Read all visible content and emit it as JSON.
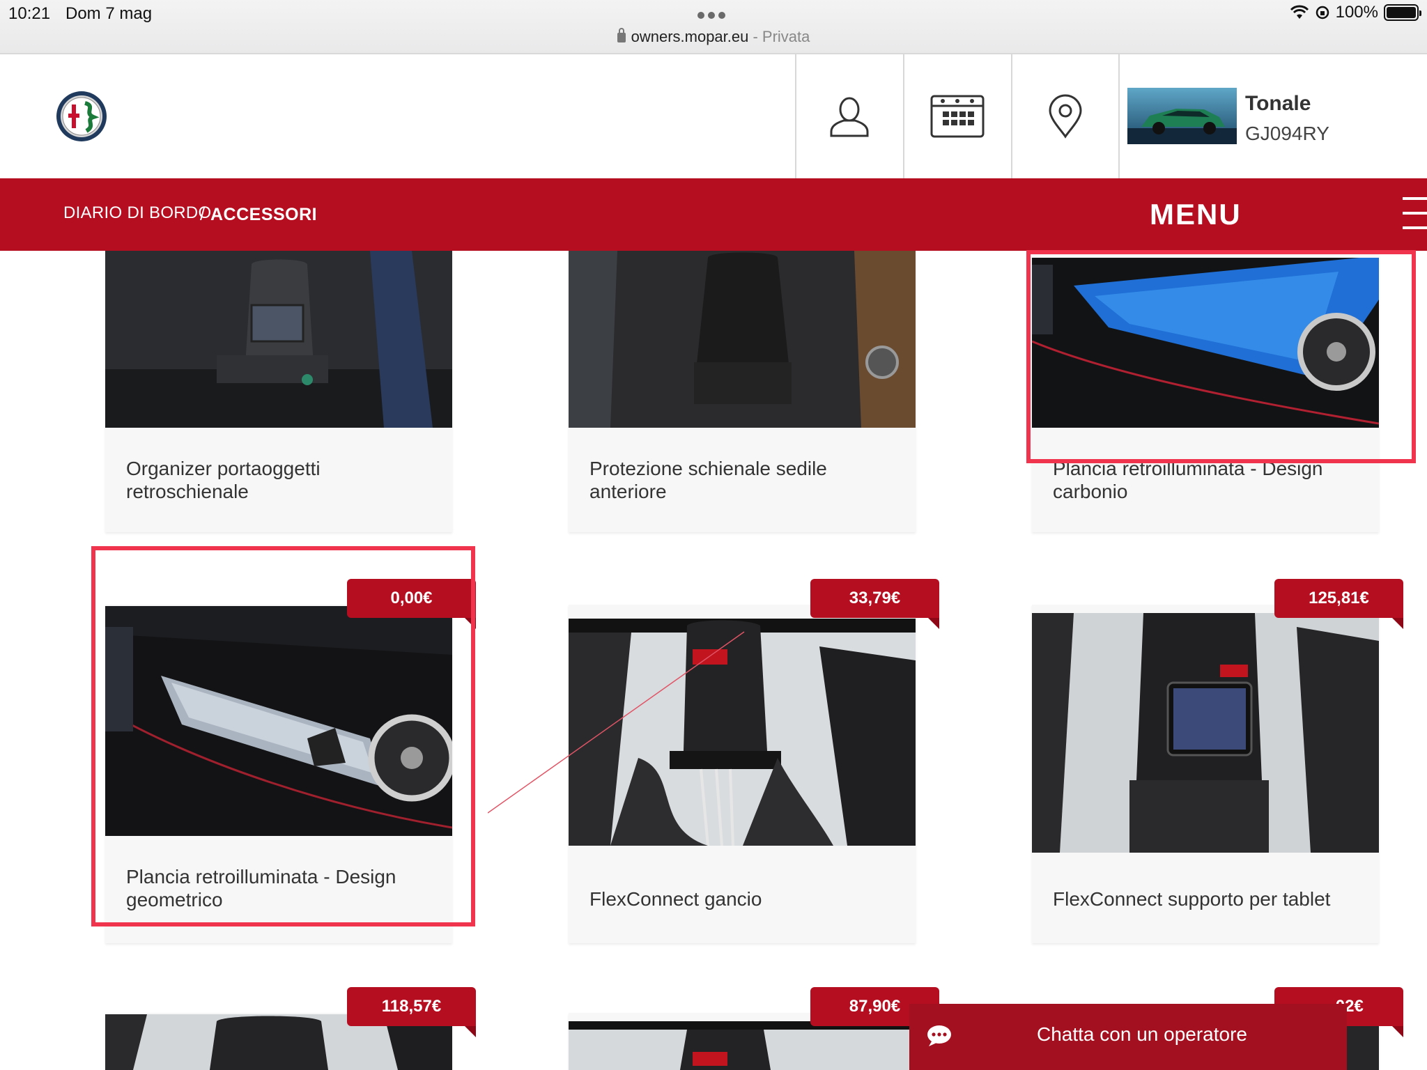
{
  "status_bar": {
    "time": "10:21",
    "date": "Dom 7 mag",
    "url": "owners.mopar.eu",
    "url_separator": " - ",
    "privacy": "Privata",
    "battery": "100%"
  },
  "header": {
    "vehicle_model": "Tonale",
    "vehicle_plate": "GJ094RY"
  },
  "nav": {
    "breadcrumb_root": "DIARIO DI BORDO",
    "breadcrumb_separator": "/",
    "breadcrumb_current": "ACCESSORI",
    "menu_label": "MENU"
  },
  "products": [
    {
      "title": "Organizer portaoggetti retroschienale",
      "price": ""
    },
    {
      "title": "Protezione schienale sedile anteriore",
      "price": ""
    },
    {
      "title": "Plancia retroilluminata - Design carbonio",
      "price": ""
    },
    {
      "title": "Plancia retroilluminata - Design geometrico",
      "price": "0,00€"
    },
    {
      "title": "FlexConnect gancio",
      "price": "33,79€"
    },
    {
      "title": "FlexConnect supporto per tablet",
      "price": "125,81€"
    },
    {
      "title": "",
      "price": "118,57€"
    },
    {
      "title": "",
      "price": "87,90€"
    },
    {
      "title": "",
      "price": "…,02€"
    }
  ],
  "chat": {
    "label": "Chatta con un operatore"
  },
  "colors": {
    "brand_red": "#b50e21",
    "highlight": "#f0344d"
  }
}
